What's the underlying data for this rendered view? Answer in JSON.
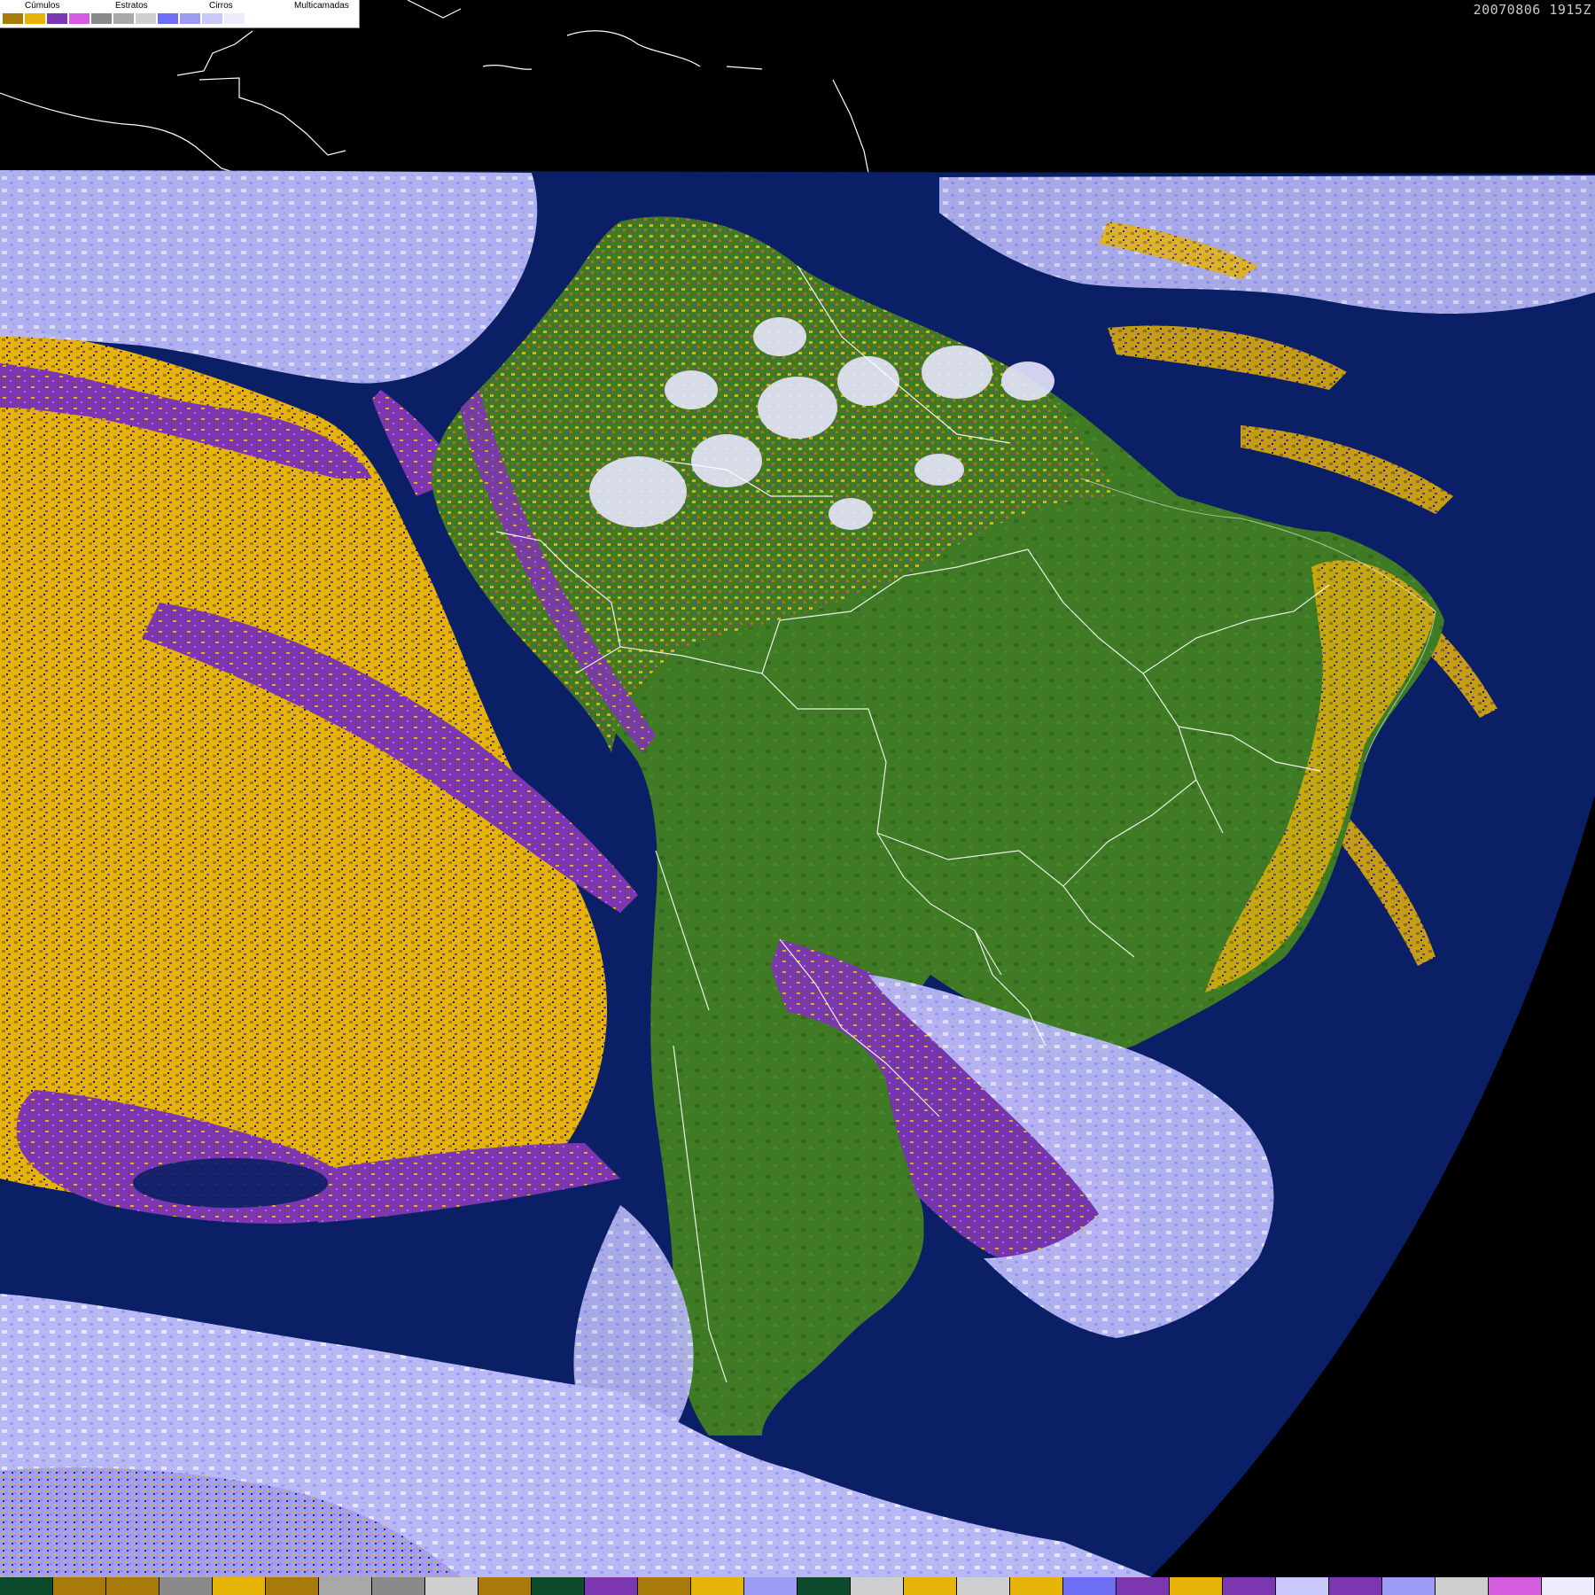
{
  "timestamp": "20070806 1915Z",
  "legend": {
    "groups": [
      {
        "label": "Cúmulos",
        "colors": [
          "#a77a0a",
          "#e6b407"
        ]
      },
      {
        "label": "Estratos",
        "colors": [
          "#7b36b0",
          "#d45de0"
        ]
      },
      {
        "label": "Cirros",
        "colors": [
          "#8a8a8a",
          "#a8a8a8",
          "#cfcfcf"
        ]
      },
      {
        "label": "Multicamadas",
        "colors": [
          "#6e6ef4",
          "#9c9cf5",
          "#c8c8fb",
          "#ececfd"
        ]
      }
    ]
  },
  "palette": {
    "space": "#000000",
    "ocean": "#0b1f66",
    "land": "#3f7a24",
    "land_dark": "#2f5e1a",
    "cumulus": "#e6b407",
    "cumulus_dark": "#a77a0a",
    "stratus": "#7b36b0",
    "stratus_light": "#d45de0",
    "cirrus": "#b0b0b0",
    "multilayer": "#b8b8f6",
    "multilayer_light": "#e6e6fd",
    "borders": "#ffffff"
  },
  "bottom_strip": [
    "#0b4a2a",
    "#a77a0a",
    "#a77a0a",
    "#8a8a8a",
    "#e6b407",
    "#a77a0a",
    "#a8a8a8",
    "#8a8a8a",
    "#cfcfcf",
    "#a77a0a",
    "#0b4a2a",
    "#7b36b0",
    "#a77a0a",
    "#e6b407",
    "#9c9cf5",
    "#0b4a2a",
    "#cfcfcf",
    "#e6b407",
    "#cfcfcf",
    "#e6b407",
    "#6e6ef4",
    "#7b36b0",
    "#e6b407",
    "#7b36b0",
    "#c8c8fb",
    "#7b36b0",
    "#9c9cf5",
    "#cfcfcf",
    "#d45de0",
    "#ececfd"
  ]
}
